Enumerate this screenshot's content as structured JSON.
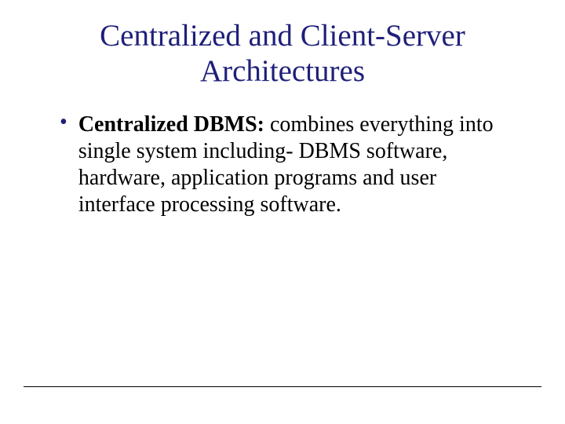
{
  "title": "Centralized and Client-Server Architectures",
  "bullet": {
    "marker": "•",
    "boldLead": "Centralized DBMS:",
    "rest": " combines everything into single system including- DBMS software, hardware, application programs and user interface processing software."
  }
}
